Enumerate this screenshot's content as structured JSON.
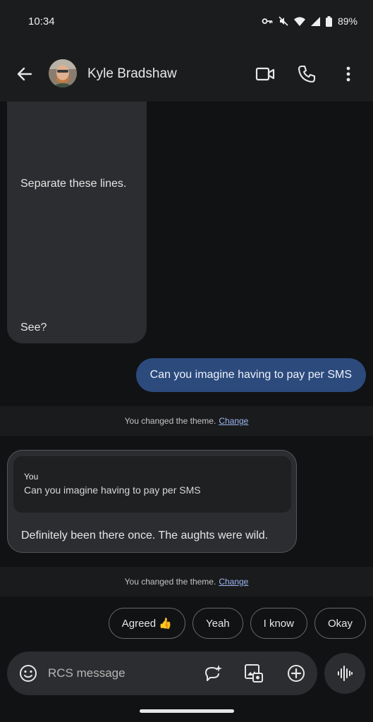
{
  "status_bar": {
    "time": "10:34",
    "battery": "89%",
    "icons": [
      "vpn-key-icon",
      "mute-icon",
      "wifi-icon",
      "signal-icon",
      "battery-icon"
    ]
  },
  "header": {
    "contact_name": "Kyle Bradshaw",
    "icons": [
      "back-arrow-icon",
      "video-call-icon",
      "phone-icon",
      "more-vert-icon"
    ]
  },
  "messages": [
    {
      "direction": "incoming",
      "lines": [
        "Separate these lines.",
        "See?"
      ]
    },
    {
      "direction": "outgoing",
      "text": "Can you imagine having to pay per SMS"
    },
    {
      "type": "system",
      "text": "You changed the theme.",
      "link": "Change"
    },
    {
      "direction": "incoming",
      "quote": {
        "author": "You",
        "text": "Can you imagine having to pay per SMS"
      },
      "text": "Definitely been there once. The aughts were wild."
    },
    {
      "type": "system",
      "text": "You changed the theme.",
      "link": "Change"
    }
  ],
  "smart_replies": [
    "Agreed 👍",
    "Yeah",
    "I know",
    "Okay"
  ],
  "compose": {
    "placeholder": "RCS message",
    "icons": [
      "emoji-icon",
      "ai-sparkle-icon",
      "gallery-icon",
      "add-icon",
      "voice-icon"
    ]
  },
  "colors": {
    "background": "#111214",
    "bar": "#1b1c1e",
    "incoming_bubble": "#2c2d30",
    "outgoing_bubble": "#2c4a7c",
    "link": "#9bb8f2"
  }
}
